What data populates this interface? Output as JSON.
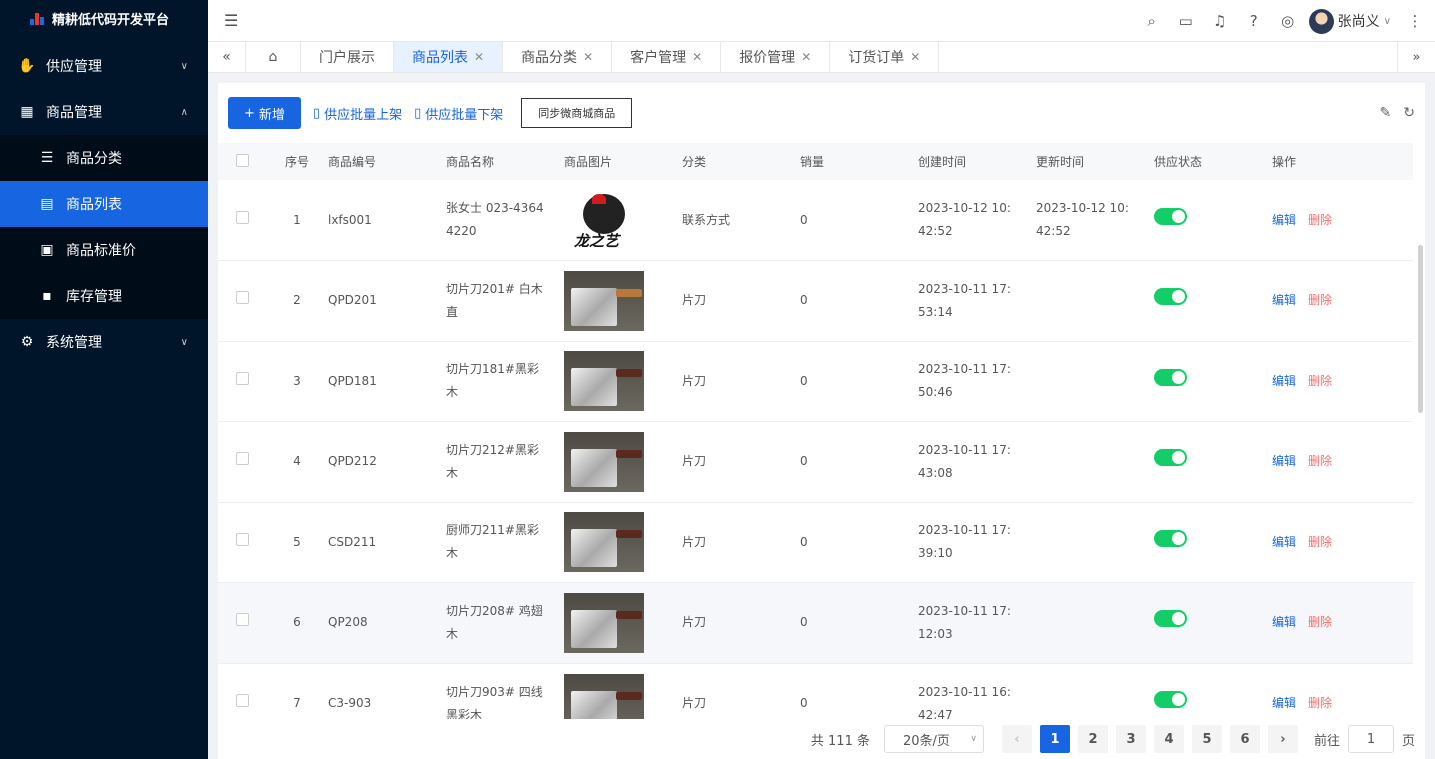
{
  "app": {
    "title": "精耕低代码开发平台"
  },
  "sidebar": {
    "items": [
      {
        "label": "供应管理",
        "icon": "supply-icon"
      },
      {
        "label": "商品管理",
        "icon": "grid-icon"
      },
      {
        "label": "商品分类",
        "icon": "sliders-icon"
      },
      {
        "label": "商品列表",
        "icon": "document-icon"
      },
      {
        "label": "商品标准价",
        "icon": "price-icon"
      },
      {
        "label": "库存管理",
        "icon": "inventory-icon"
      },
      {
        "label": "系统管理",
        "icon": "gear-icon"
      }
    ]
  },
  "header": {
    "user_name": "张尚义"
  },
  "tabs": [
    {
      "label": "门户展示"
    },
    {
      "label": "商品列表"
    },
    {
      "label": "商品分类"
    },
    {
      "label": "客户管理"
    },
    {
      "label": "报价管理"
    },
    {
      "label": "订货订单"
    }
  ],
  "toolbar": {
    "add_label": "新增",
    "batch_up_label": "供应批量上架",
    "batch_down_label": "供应批量下架",
    "sync_label": "同步微商城商品"
  },
  "table": {
    "columns": [
      "序号",
      "商品编号",
      "商品名称",
      "商品图片",
      "分类",
      "销量",
      "创建时间",
      "更新时间",
      "供应状态",
      "操作"
    ],
    "edit_label": "编辑",
    "delete_label": "删除",
    "rows": [
      {
        "no": "1",
        "code": "lxfs001",
        "name": "张女士 023-43644220",
        "category": "联系方式",
        "sales": "0",
        "created": "2023-10-12 10:42:52",
        "updated": "2023-10-12 10:42:52",
        "logo_text": "龙之艺"
      },
      {
        "no": "2",
        "code": "QPD201",
        "name": "切片刀201# 白木直",
        "category": "片刀",
        "sales": "0",
        "created": "2023-10-11 17:53:14",
        "updated": ""
      },
      {
        "no": "3",
        "code": "QPD181",
        "name": "切片刀181#黑彩木",
        "category": "片刀",
        "sales": "0",
        "created": "2023-10-11 17:50:46",
        "updated": ""
      },
      {
        "no": "4",
        "code": "QPD212",
        "name": "切片刀212#黑彩木",
        "category": "片刀",
        "sales": "0",
        "created": "2023-10-11 17:43:08",
        "updated": ""
      },
      {
        "no": "5",
        "code": "CSD211",
        "name": "厨师刀211#黑彩木",
        "category": "片刀",
        "sales": "0",
        "created": "2023-10-11 17:39:10",
        "updated": ""
      },
      {
        "no": "6",
        "code": "QP208",
        "name": "切片刀208# 鸡翅木",
        "category": "片刀",
        "sales": "0",
        "created": "2023-10-11 17:12:03",
        "updated": ""
      },
      {
        "no": "7",
        "code": "C3-903",
        "name": "切片刀903# 四线黑彩木",
        "category": "片刀",
        "sales": "0",
        "created": "2023-10-11 16:42:47",
        "updated": ""
      }
    ]
  },
  "pagination": {
    "total_text": "共 111 条",
    "page_size": "20条/页",
    "pages": [
      "1",
      "2",
      "3",
      "4",
      "5",
      "6"
    ],
    "goto_label": "前往",
    "goto_value": "1",
    "page_suffix": "页"
  },
  "colors": {
    "primary": "#1765e0",
    "switch_on": "#13ce66",
    "danger": "#f56c6c",
    "sidebar_bg": "#001529"
  }
}
